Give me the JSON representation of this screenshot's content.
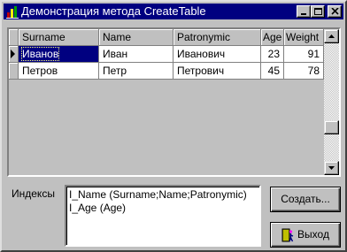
{
  "window": {
    "title": "Демонстрация метода CreateTable"
  },
  "grid": {
    "columns": [
      "Surname",
      "Name",
      "Patronymic",
      "Age",
      "Weight"
    ],
    "rows": [
      {
        "surname": "Иванов",
        "name": "Иван",
        "patronymic": "Иванович",
        "age": "23",
        "weight": "91"
      },
      {
        "surname": "Петров",
        "name": "Петр",
        "patronymic": "Петрович",
        "age": "45",
        "weight": "78"
      }
    ]
  },
  "indexes": {
    "label": "Индексы",
    "items": [
      "I_Name (Surname;Name;Patronymic)",
      "I_Age (Age)"
    ]
  },
  "buttons": {
    "create": "Создать...",
    "exit": "Выход"
  },
  "colors": {
    "titlebar": "#000080",
    "face": "#c0c0c0",
    "selection": "#000080"
  },
  "icons": {
    "app": "app-icon",
    "minimize": "minimize-icon",
    "maximize": "maximize-icon",
    "close": "close-icon",
    "row_pointer": "row-pointer-icon",
    "exit": "exit-door-icon"
  }
}
